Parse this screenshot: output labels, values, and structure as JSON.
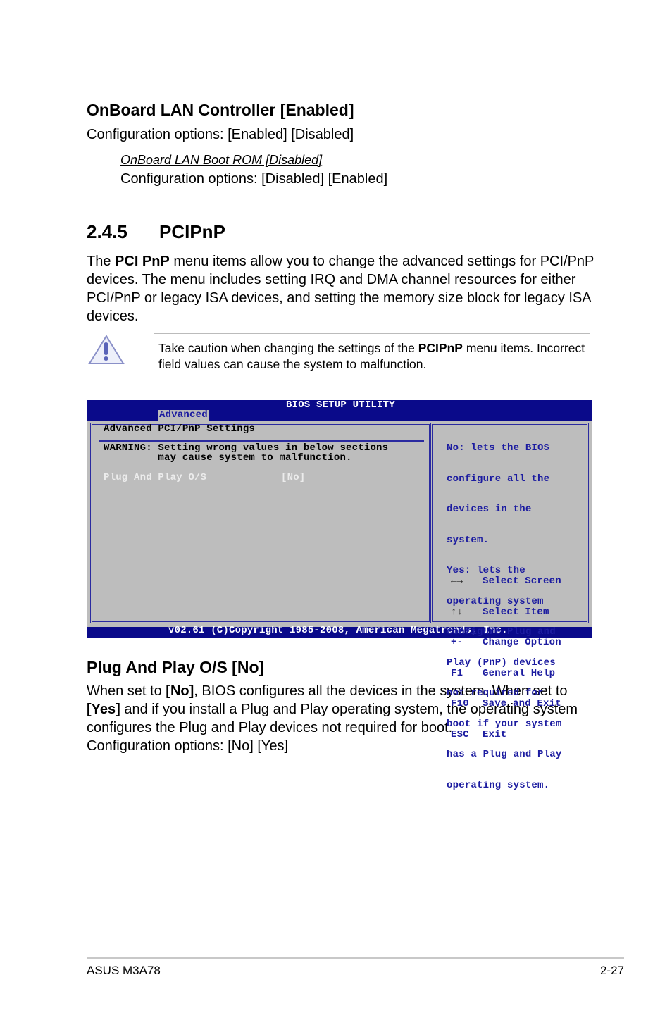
{
  "section1": {
    "heading": "OnBoard LAN Controller [Enabled]",
    "options": "Configuration options: [Enabled] [Disabled]",
    "sub_heading": "OnBoard LAN Boot ROM [Disabled]",
    "sub_options": "Configuration options: [Disabled] [Enabled]"
  },
  "section2": {
    "number": "2.4.5",
    "title": "PCIPnP",
    "intro_pre": "The ",
    "intro_bold": "PCI PnP",
    "intro_line1": " menu items allow you to change the advanced settings for PCI/PnP",
    "intro_line2": "devices. The menu includes setting IRQ and DMA channel resources for either",
    "intro_line3": "PCI/PnP or legacy ISA devices, and setting the memory size block for legacy ISA",
    "intro_line4": "devices."
  },
  "caution": {
    "icon": "warning-triangle-icon",
    "pre": "Take caution when changing the settings of the ",
    "bold": "PCIPnP",
    "post": " menu items. Incorrect",
    "line2": "field values can cause the system to malfunction."
  },
  "bios": {
    "title": "BIOS SETUP UTILITY",
    "tab": "Advanced",
    "heading": "Advanced PCI/PnP Settings",
    "warning_line1": "WARNING: Setting wrong values in below sections",
    "warning_line2": "         may cause system to malfunction.",
    "item_label": "Plug And Play O/S",
    "item_value": "[No]",
    "help": [
      "No: lets the BIOS",
      "configure all the",
      "devices in the",
      "system.",
      "Yes: lets the",
      "operating system",
      "configure Plug and",
      "Play (PnP) devices",
      "not required for",
      "boot if your system",
      "has a Plug and Play",
      "operating system."
    ],
    "keys": [
      {
        "key": "←→",
        "action": "Select Screen"
      },
      {
        "key": "↑↓",
        "action": "Select Item"
      },
      {
        "key": "+-",
        "action": "Change Option"
      },
      {
        "key": "F1",
        "action": "General Help"
      },
      {
        "key": "F10",
        "action": "Save and Exit"
      },
      {
        "key": "ESC",
        "action": "Exit"
      }
    ],
    "footer": "v02.61 (C)Copyright 1985-2008, American Megatrends, Inc.",
    "colors": {
      "bar": "#0a0a8a",
      "panel": "#bdbdbd",
      "text": "#1c1ca0"
    }
  },
  "section3": {
    "heading": "Plug And Play O/S [No]",
    "l1_pre": "When set to ",
    "l1_bold": "[No]",
    "l1_post": ", BIOS configures all the devices in the system. When set to",
    "l2_bold": "[Yes]",
    "l2_post": " and if you install a Plug and Play operating system, the operating system",
    "l3": "configures the Plug and Play devices not required for boot.",
    "l4": "Configuration options: [No] [Yes]"
  },
  "footer": {
    "left": "ASUS M3A78",
    "right": "2-27"
  }
}
